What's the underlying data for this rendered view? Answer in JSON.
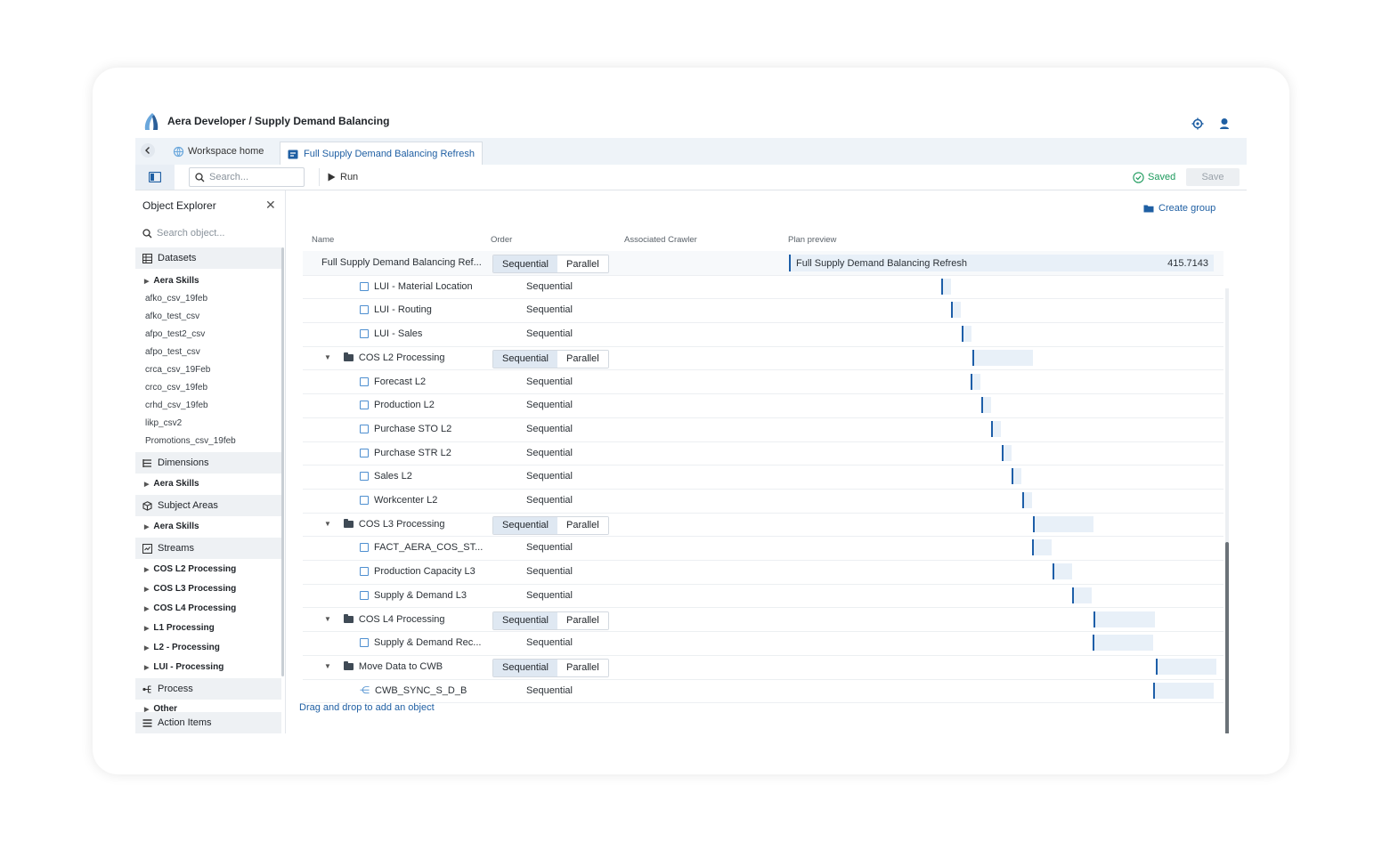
{
  "app": {
    "title": "Aera Developer / Supply Demand Balancing"
  },
  "tabs": {
    "home_label": "Workspace home",
    "active_label": "Full Supply Demand Balancing Refresh"
  },
  "toolbar": {
    "search_placeholder": "Search...",
    "run_label": "Run",
    "saved_label": "Saved",
    "save_label": "Save"
  },
  "explorer": {
    "title": "Object Explorer",
    "search_placeholder": "Search object...",
    "datasets_label": "Datasets",
    "datasets_sub": "Aera Skills",
    "datasets_items": [
      "afko_csv_19feb",
      "afko_test_csv",
      "afpo_test2_csv",
      "afpo_test_csv",
      "crca_csv_19Feb",
      "crco_csv_19feb",
      "crhd_csv_19feb",
      "likp_csv2",
      "Promotions_csv_19feb"
    ],
    "dimensions_label": "Dimensions",
    "dimensions_sub": "Aera Skills",
    "subject_label": "Subject Areas",
    "subject_sub": "Aera Skills",
    "streams_label": "Streams",
    "streams_items": [
      "COS L2 Processing",
      "COS L3 Processing",
      "COS L4 Processing",
      "L1 Processing",
      "L2 - Processing",
      "LUI - Processing"
    ],
    "process_label": "Process",
    "process_sub": "Other",
    "action_label": "Action Items"
  },
  "main": {
    "create_group": "Create group",
    "headers": {
      "name": "Name",
      "order": "Order",
      "crawler": "Associated Crawler",
      "plan": "Plan preview"
    },
    "order_sequential": "Sequential",
    "order_parallel": "Parallel",
    "plan_first_label": "Full Supply Demand Balancing Refresh",
    "plan_first_value": "415.7143",
    "drag_drop": "Drag and drop to add an object",
    "rows": [
      {
        "name": "Full Supply Demand Balancing Ref...",
        "kind": "root"
      },
      {
        "name": "LUI - Material Location",
        "kind": "stream"
      },
      {
        "name": "LUI - Routing",
        "kind": "stream"
      },
      {
        "name": "LUI - Sales",
        "kind": "stream"
      },
      {
        "name": "COS L2 Processing",
        "kind": "group"
      },
      {
        "name": "Forecast L2",
        "kind": "stream"
      },
      {
        "name": "Production L2",
        "kind": "stream"
      },
      {
        "name": "Purchase STO L2",
        "kind": "stream"
      },
      {
        "name": "Purchase STR L2",
        "kind": "stream"
      },
      {
        "name": "Sales L2",
        "kind": "stream"
      },
      {
        "name": "Workcenter L2",
        "kind": "stream"
      },
      {
        "name": "COS L3 Processing",
        "kind": "group"
      },
      {
        "name": "FACT_AERA_COS_ST...",
        "kind": "stream"
      },
      {
        "name": "Production Capacity L3",
        "kind": "stream"
      },
      {
        "name": "Supply & Demand L3",
        "kind": "stream"
      },
      {
        "name": "COS L4 Processing",
        "kind": "group"
      },
      {
        "name": "Supply & Demand Rec...",
        "kind": "stream"
      },
      {
        "name": "Move Data to CWB",
        "kind": "group"
      },
      {
        "name": "CWB_SYNC_S_D_B",
        "kind": "process"
      }
    ]
  },
  "colors": {
    "accent": "#1f5fa3",
    "bar_fill": "#e8f0f8",
    "bar_tick": "#1d5ea8",
    "saved": "#1c9a5c"
  }
}
